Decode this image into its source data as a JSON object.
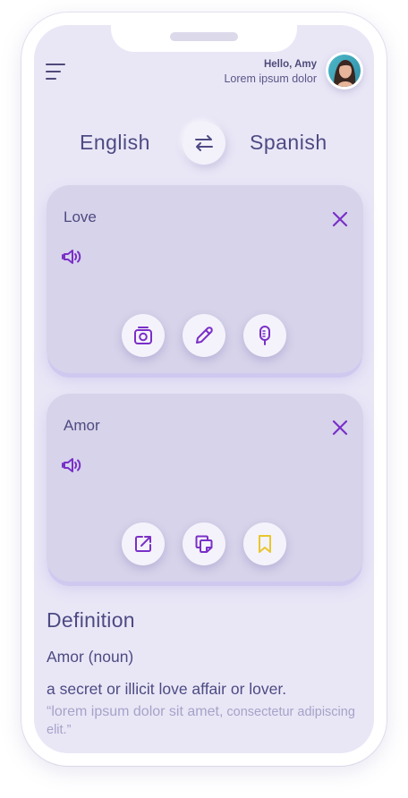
{
  "header": {
    "greeting": "Hello, Amy",
    "subtitle": "Lorem ipsum dolor",
    "menu_icon": "hamburger-menu-icon",
    "avatar_icon": "user-avatar"
  },
  "languages": {
    "source": "English",
    "target": "Spanish",
    "swap_icon": "swap-arrows-icon"
  },
  "input_card": {
    "text": "Love",
    "icons": [
      "close-icon",
      "speaker-icon",
      "camera-icon",
      "pencil-icon",
      "microphone-icon"
    ]
  },
  "output_card": {
    "text": "Amor",
    "icons": [
      "close-icon",
      "speaker-icon",
      "share-external-icon",
      "copy-icon",
      "bookmark-icon"
    ]
  },
  "definition": {
    "title": "Definition",
    "word": "Amor (noun)",
    "meaning": "a secret or illicit love affair or lover.",
    "quote_part1": "“lorem ipsum dolor sit amet,",
    "quote_part2": " consectetur adipiscing elit.”"
  },
  "colors": {
    "accent_purple": "#7a2fc7",
    "text_dark": "#4d4a83",
    "bookmark_yellow": "#e8c62f",
    "screen_bg": "#e9e7f6",
    "card_bg": "#d6d3ea"
  }
}
